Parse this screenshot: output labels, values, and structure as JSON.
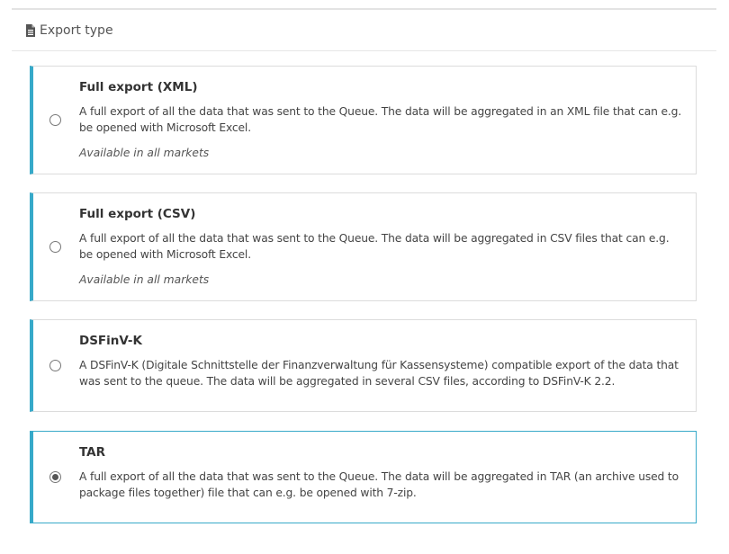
{
  "section": {
    "title": "Export type",
    "icon": "document-icon"
  },
  "accent_color": "#37a9c9",
  "options": [
    {
      "title": "Full export (XML)",
      "description": "A full export of all the data that was sent to the Queue. The data will be aggregated in an XML file that can e.g. be opened with Microsoft Excel.",
      "availability": "Available in all markets",
      "selected": false
    },
    {
      "title": "Full export (CSV)",
      "description": "A full export of all the data that was sent to the Queue. The data will be aggregated in CSV files that can e.g. be opened with Microsoft Excel.",
      "availability": "Available in all markets",
      "selected": false
    },
    {
      "title": "DSFinV-K",
      "description": "A DSFinV-K (Digitale Schnittstelle der Finanzverwaltung für Kassensysteme) compatible export of the data that was sent to the queue. The data will be aggregated in several CSV files, according to DSFinV-K 2.2.",
      "selected": false
    },
    {
      "title": "TAR",
      "description": "A full export of all the data that was sent to the Queue. The data will be aggregated in TAR (an archive used to package files together) file that can e.g. be opened with 7-zip.",
      "selected": true
    }
  ]
}
